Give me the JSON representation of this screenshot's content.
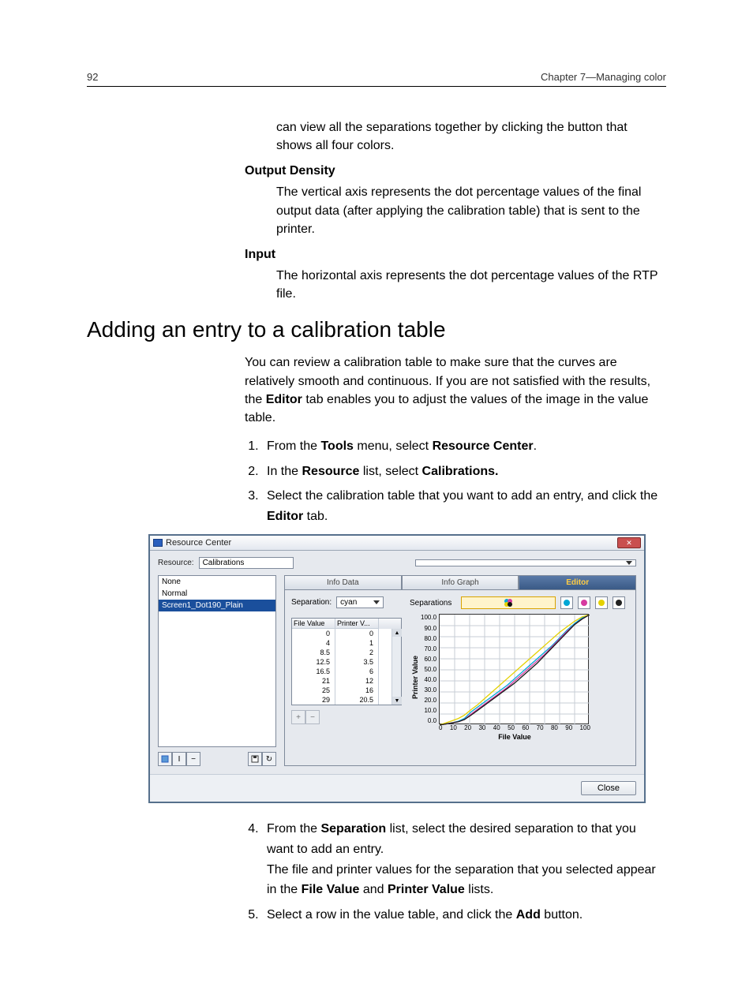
{
  "header": {
    "page": "92",
    "chapter": "Chapter 7—Managing color"
  },
  "intro_para": "can view all the separations together by clicking the button that shows all four colors.",
  "terms": {
    "output_density": {
      "title": "Output Density",
      "body": "The vertical axis represents the dot percentage values of the final output data (after applying the calibration table) that is sent to the printer."
    },
    "input": {
      "title": "Input",
      "body": "The horizontal axis represents the dot percentage values of the RTP file."
    }
  },
  "section_title": "Adding an entry to a calibration table",
  "section_para": "You can review a calibration table to make sure that the curves are relatively smooth and continuous. If you are not satisfied with the results, the Editor tab enables you to adjust the values of the image in the value table.",
  "steps": {
    "s1a": "From the ",
    "s1b": "Tools",
    "s1c": " menu, select ",
    "s1d": "Resource Center",
    "s1e": ".",
    "s2a": "In the ",
    "s2b": "Resource",
    "s2c": " list, select ",
    "s2d": "Calibrations.",
    "s3a": "Select the calibration table that you want to add an entry, and click the ",
    "s3b": "Editor",
    "s3c": " tab.",
    "s4a": "From the ",
    "s4b": "Separation",
    "s4c": " list, select the desired separation to that you want to add an entry.",
    "s4d": "The file and printer values for the separation that you selected appear in the ",
    "s4e": "File Value",
    "s4f": " and ",
    "s4g": "Printer Value",
    "s4h": " lists.",
    "s5a": "Select a row in the value table, and click the ",
    "s5b": "Add",
    "s5c": " button."
  },
  "dialog": {
    "title": "Resource Center",
    "resource_label": "Resource:",
    "resource_value": "Calibrations",
    "list": {
      "items": [
        "None",
        "Normal",
        "Screen1_Dot190_Plain"
      ],
      "selected_index": 2
    },
    "tabs": {
      "info_data": "Info Data",
      "info_graph": "Info Graph",
      "editor": "Editor"
    },
    "separation_label": "Separation:",
    "separation_value": "cyan",
    "separations_label": "Separations",
    "table": {
      "h1": "File Value",
      "h2": "Printer V...",
      "rows": [
        {
          "f": "0",
          "p": "0"
        },
        {
          "f": "4",
          "p": "1"
        },
        {
          "f": "8.5",
          "p": "2"
        },
        {
          "f": "12.5",
          "p": "3.5"
        },
        {
          "f": "16.5",
          "p": "6"
        },
        {
          "f": "21",
          "p": "12"
        },
        {
          "f": "25",
          "p": "16"
        },
        {
          "f": "29",
          "p": "20.5"
        }
      ]
    },
    "add_btn": "+",
    "remove_btn": "−",
    "chart": {
      "ylabel": "Printer Value",
      "xlabel": "File Value",
      "yticks": [
        "100.0",
        "90.0",
        "80.0",
        "70.0",
        "60.0",
        "50.0",
        "40.0",
        "30.0",
        "20.0",
        "10.0",
        "0.0"
      ],
      "xticks": [
        "0",
        "10",
        "20",
        "30",
        "40",
        "50",
        "60",
        "70",
        "80",
        "90",
        "100"
      ]
    },
    "close": "Close"
  },
  "chart_data": {
    "type": "line",
    "title": "",
    "xlabel": "File Value",
    "ylabel": "Printer Value",
    "xlim": [
      0,
      100
    ],
    "ylim": [
      0,
      100
    ],
    "x": [
      0,
      4,
      8.5,
      12.5,
      16.5,
      21,
      25,
      30,
      35,
      40,
      45,
      50,
      55,
      60,
      65,
      70,
      75,
      80,
      85,
      90,
      95,
      100
    ],
    "series": [
      {
        "name": "cyan",
        "color": "#00a7d6",
        "values": [
          0,
          1,
          2,
          3.5,
          6,
          12,
          16,
          21,
          26,
          31,
          36,
          42,
          48,
          54,
          60,
          66,
          72,
          79,
          86,
          92,
          97,
          100
        ]
      },
      {
        "name": "magenta",
        "color": "#d63aa0",
        "values": [
          0,
          1,
          2,
          3,
          5,
          10,
          14,
          19,
          24,
          29,
          34,
          40,
          46,
          52,
          58,
          64,
          71,
          78,
          85,
          91,
          96,
          100
        ]
      },
      {
        "name": "yellow",
        "color": "#e4d100",
        "values": [
          0,
          2,
          4,
          6,
          9,
          14,
          18,
          24,
          30,
          36,
          42,
          48,
          54,
          60,
          66,
          72,
          78,
          84,
          89,
          94,
          98,
          100
        ]
      },
      {
        "name": "black",
        "color": "#1a1a1a",
        "values": [
          0,
          1,
          2,
          3,
          5,
          9,
          13,
          18,
          23,
          28,
          33,
          38,
          44,
          50,
          56,
          63,
          70,
          77,
          84,
          91,
          96,
          100
        ]
      }
    ]
  }
}
